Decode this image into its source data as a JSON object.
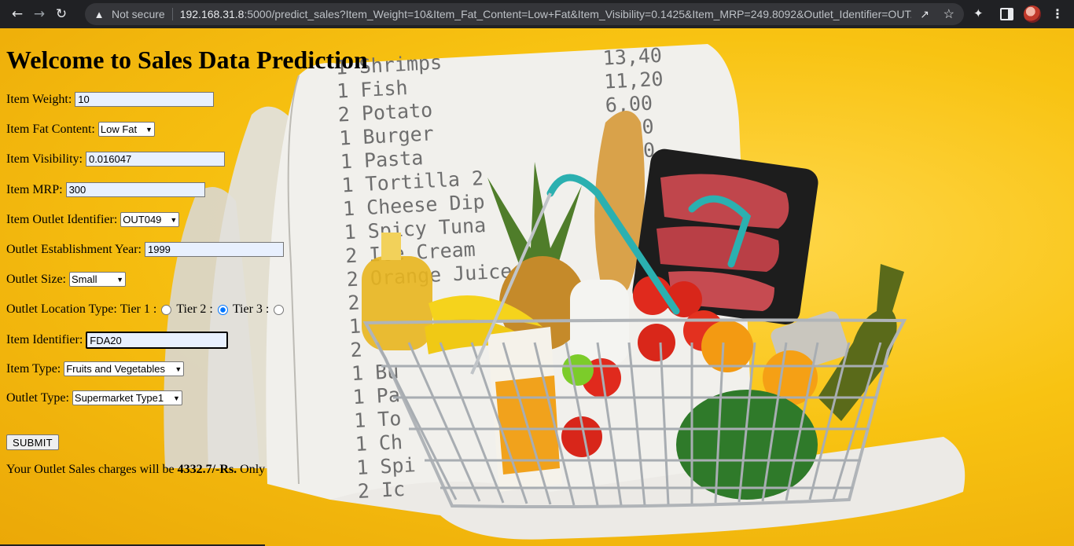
{
  "browser": {
    "security_label": "Not secure",
    "url_host": "192.168.31.8",
    "url_rest": ":5000/predict_sales?Item_Weight=10&Item_Fat_Content=Low+Fat&Item_Visibility=0.1425&Item_MRP=249.8092&Outlet_Identifier=OUT..."
  },
  "page": {
    "title": "Welcome to Sales Data Prediction",
    "fields": {
      "item_weight": {
        "label": "Item Weight:",
        "value": "10"
      },
      "item_fat_content": {
        "label": "Item Fat Content:",
        "value": "Low Fat"
      },
      "item_visibility": {
        "label": "Item Visibility:",
        "value": "0.016047"
      },
      "item_mrp": {
        "label": "Item MRP:",
        "value": "300"
      },
      "outlet_identifier": {
        "label": "Item Outlet Identifier:",
        "value": "OUT049"
      },
      "establishment_year": {
        "label": "Outlet Establishment Year:",
        "value": "1999"
      },
      "outlet_size": {
        "label": "Outlet Size:",
        "value": "Small"
      },
      "location_type": {
        "label": "Outlet Location Type:",
        "options": [
          "Tier 1 :",
          "Tier 2 :",
          "Tier 3 :"
        ],
        "selected": "Tier 2 :"
      },
      "item_identifier": {
        "label": "Item Identifier:",
        "value": "FDA20"
      },
      "item_type": {
        "label": "Item Type:",
        "value": "Fruits and Vegetables"
      },
      "outlet_type": {
        "label": "Outlet Type:",
        "value": "Supermarket Type1"
      }
    },
    "submit_label": "SUBMIT",
    "result": {
      "prefix": "Your Outlet Sales charges will be ",
      "amount": "4332.7/-Rs.",
      "suffix": " Only"
    }
  },
  "receipt": {
    "lines": [
      "1 Shrimps",
      "1 Fish",
      "2 Potato",
      "1 Burger",
      "1 Pasta",
      "1 Tortilla 2",
      "1 Cheese Dip",
      "1 Spicy Tuna",
      "2 Ice Cream",
      "2 Orange Juice",
      "2",
      "1",
      "2",
      "1 Bu",
      "1 Pa",
      "1 To",
      "1 Ch",
      "1 Spi",
      "2 Ic"
    ],
    "prices": [
      "13,40",
      "11,20",
      "6,00",
      "8,00",
      "4,50"
    ]
  },
  "colors": {
    "background": "#f8c312",
    "chrome": "#202124",
    "omnibox": "#35363a",
    "autofill": "#e8f0fe",
    "radio_accent": "#0075ff"
  }
}
